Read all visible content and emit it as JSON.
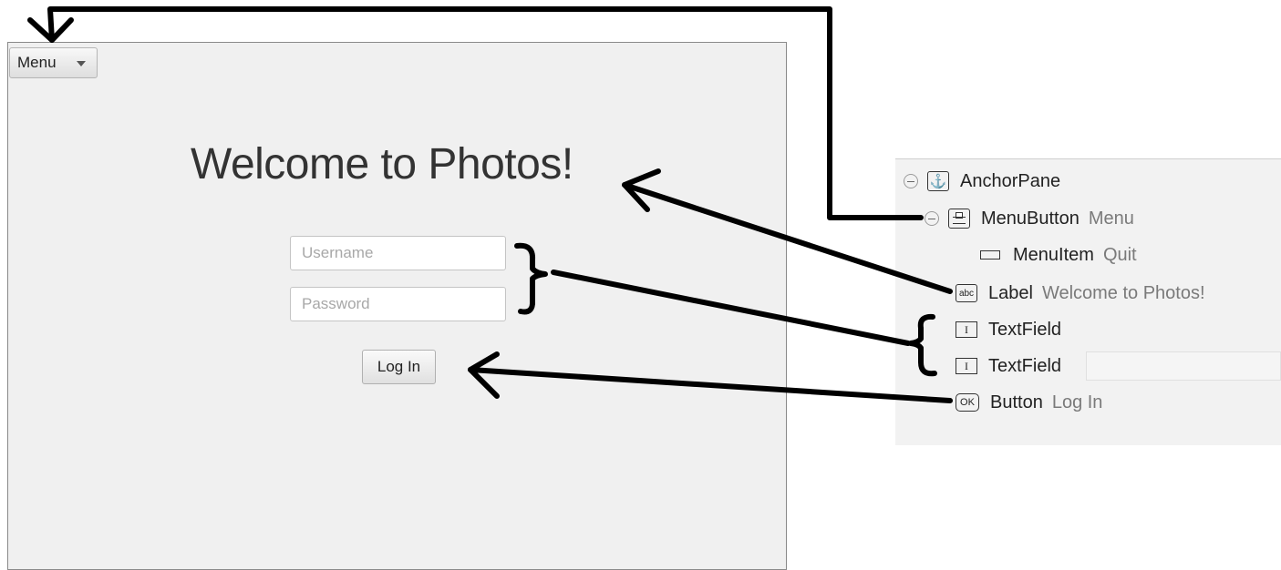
{
  "app": {
    "menu_button": {
      "label": "Menu"
    },
    "welcome_label": "Welcome to Photos!",
    "username_field": {
      "placeholder": "Username",
      "value": ""
    },
    "password_field": {
      "placeholder": "Password",
      "value": ""
    },
    "login_button": {
      "label": "Log In"
    }
  },
  "hierarchy": {
    "nodes": [
      {
        "type": "AnchorPane",
        "value": "",
        "icon": "anchor-icon"
      },
      {
        "type": "MenuButton",
        "value": "Menu",
        "icon": "menubutton-icon"
      },
      {
        "type": "MenuItem",
        "value": "Quit",
        "icon": "menuitem-icon"
      },
      {
        "type": "Label",
        "value": "Welcome to Photos!",
        "icon": "label-icon"
      },
      {
        "type": "TextField",
        "value": "",
        "icon": "textfield-icon"
      },
      {
        "type": "TextField",
        "value": "",
        "icon": "textfield-icon"
      },
      {
        "type": "Button",
        "value": "Log In",
        "icon": "button-icon"
      }
    ],
    "icon_text": {
      "label": "abc",
      "textfield": "I",
      "button": "OK"
    }
  },
  "colors": {
    "annotation": "#000000",
    "window_bg": "#f0f0f0",
    "panel_bg": "#f2f2f2",
    "value_text": "#7a7a7a"
  }
}
